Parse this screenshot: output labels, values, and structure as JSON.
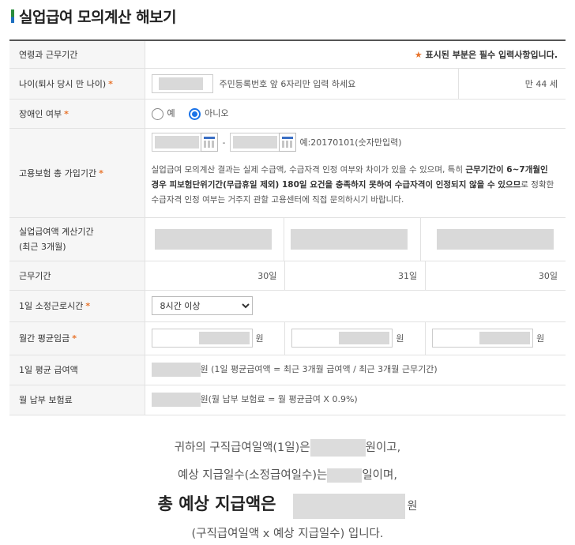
{
  "page_title": "실업급여 모의계산 해보기",
  "section": {
    "label": "연령과 근무기간",
    "required_note_star": "★",
    "required_note": "표시된 부분은 필수 입력사항입니다."
  },
  "age": {
    "label": "나이(퇴사 당시 만 나이)",
    "hint": "주민등록번호 앞 6자리만 입력 하세요",
    "result": "만 44 세"
  },
  "disability": {
    "label": "장애인 여부",
    "options": [
      "예",
      "아니오"
    ],
    "selected": "아니오"
  },
  "insurance_period": {
    "label": "고용보험 총 가입기간",
    "separator": "-",
    "example": "예:20170101(숫자만입력)",
    "notice_1": "실업급여 모의계산 결과는 실제 수급액, 수급자격 인정 여부와 차이가 있을 수 있으며, 특히 ",
    "notice_bold": "근무기간이 6~7개월인 경우 피보험단위기간(무급휴일 제외) 180일 요건을 충족하지 못하여 수급자격이 인정되지 않을 수 있으므",
    "notice_2": "로 정확한 수급자격 인정 여부는 거주지 관할 고용센터에 직접 문의하시기 바랍니다."
  },
  "calc_period": {
    "label_line1": "실업급여액 계산기간",
    "label_line2": "(최근 3개월)"
  },
  "work_days": {
    "label": "근무기간",
    "values": [
      "30일",
      "31일",
      "30일"
    ]
  },
  "daily_hours": {
    "label": "1일 소정근로시간",
    "selected": "8시간 이상"
  },
  "monthly_wage": {
    "label": "월간 평균임금",
    "unit": "원"
  },
  "daily_benefit": {
    "label": "1일 평균 급여액",
    "formula": "원 (1일 평균급여액 = 최근 3개월 급여액 / 최근 3개월 근무기간)"
  },
  "premium": {
    "label": "월 납부 보험료",
    "formula": "원(월 납부 보험료 = 월 평균급여 X 0.9%)"
  },
  "summary": {
    "line1_pre": "귀하의 구직급여일액(1일)은",
    "line1_post": "원이고,",
    "line2_pre": "예상 지급일수(소정급여일수)는",
    "line2_post": "일이며,",
    "line3_bold": "총 예상 지급액은",
    "line3_pre": "은",
    "line3_post": "원",
    "line4": "(구직급여일액 x 예상 지급일수) 입니다."
  }
}
